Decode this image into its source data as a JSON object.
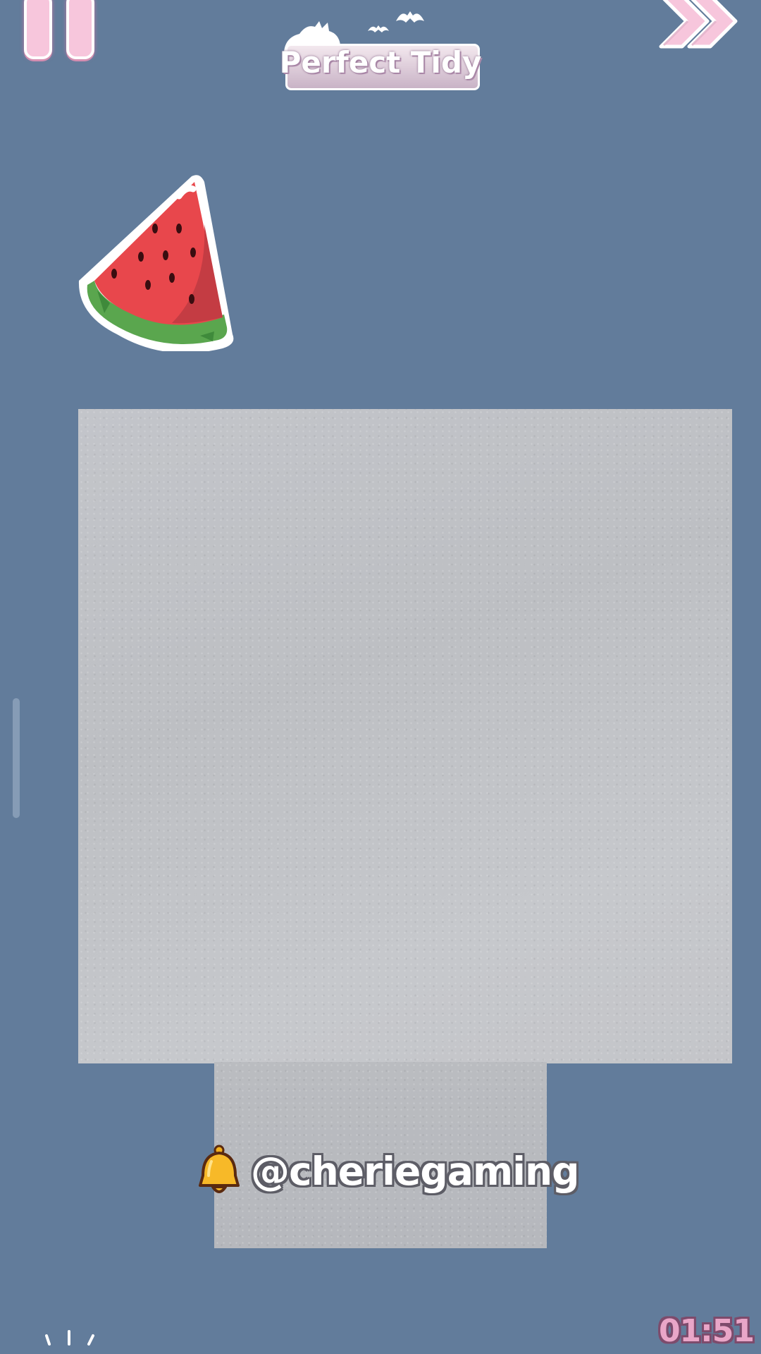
{
  "header": {
    "logo_text": "Perfect Tidy",
    "pause_icon": "pause-icon",
    "skip_icon": "double-chevron-right-icon"
  },
  "game": {
    "item_icon": "watermelon-slice-icon",
    "board_color": "#c3c5ca"
  },
  "overlay": {
    "bell_icon": "bell-icon",
    "channel_handle": "@cheriegaming"
  },
  "footer": {
    "timer": "01:51",
    "sparkle_icon": "sparkle-icon"
  },
  "colors": {
    "background": "#627c9b",
    "accent_pink": "#f7c6dc",
    "timer_pink": "#e9a6c8"
  }
}
